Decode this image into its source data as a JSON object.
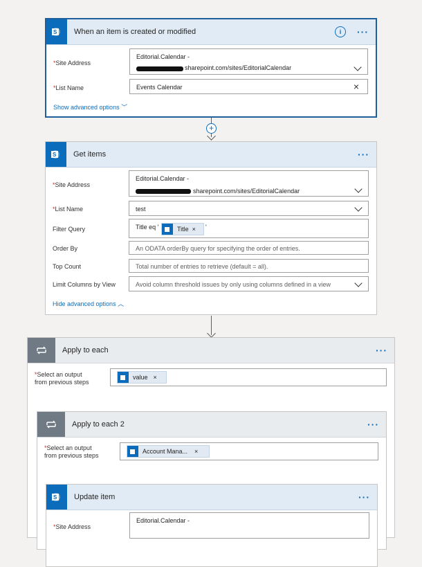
{
  "trigger": {
    "title": "When an item is created or modified",
    "site_address_label": "Site Address",
    "site_address_line1": "Editorial.Calendar -",
    "site_address_line2": "sharepoint.com/sites/EditorialCalendar",
    "list_name_label": "List Name",
    "list_name_value": "Events Calendar",
    "advanced_link": "Show advanced options"
  },
  "get_items": {
    "title": "Get items",
    "site_address_label": "Site Address",
    "site_address_line1": "Editorial.Calendar -",
    "site_address_line2": "sharepoint.com/sites/EditorialCalendar",
    "list_name_label": "List Name",
    "list_name_value": "test",
    "filter_label": "Filter Query",
    "filter_prefix": "Title eq '",
    "filter_token": "Title",
    "filter_suffix": "'",
    "order_label": "Order By",
    "order_placeholder": "An ODATA orderBy query for specifying the order of entries.",
    "top_label": "Top Count",
    "top_placeholder": "Total number of entries to retrieve (default = all).",
    "limit_label": "Limit Columns by View",
    "limit_placeholder": "Avoid column threshold issues by only using columns defined in a view",
    "advanced_link": "Hide advanced options"
  },
  "apply1": {
    "title": "Apply to each",
    "select_label_1": "Select an output",
    "select_label_2": "from previous steps",
    "token": "value"
  },
  "apply2": {
    "title": "Apply to each 2",
    "select_label_1": "Select an output",
    "select_label_2": "from previous steps",
    "token": "Account Mana..."
  },
  "update": {
    "title": "Update item",
    "site_address_label": "Site Address",
    "site_address_line1": "Editorial.Calendar -"
  },
  "symbols": {
    "required": "*",
    "dots": "···",
    "info": "i",
    "close": "×",
    "token_close": "×",
    "chevron_down": "﹀",
    "chevron_up": "︿"
  },
  "colors": {
    "accent": "#0b6cbb",
    "header_bg": "#e1ebf5",
    "loop_tile": "#6f7a85",
    "required": "#c4312b"
  }
}
